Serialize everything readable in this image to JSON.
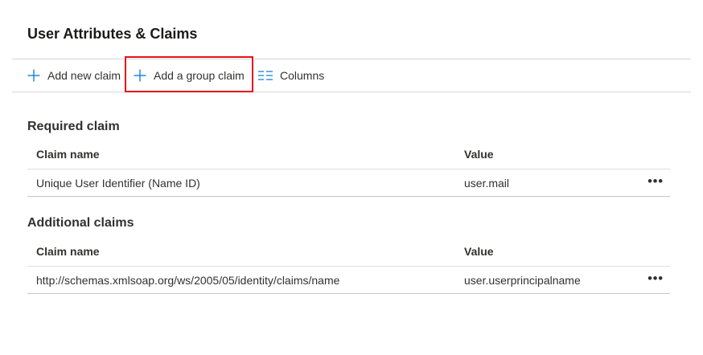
{
  "page": {
    "title": "User Attributes & Claims"
  },
  "toolbar": {
    "add_claim_label": "Add new claim",
    "add_group_claim_label": "Add a group claim",
    "columns_label": "Columns"
  },
  "colors": {
    "accent": "#0078d4",
    "highlight": "#e8101a"
  },
  "icons": {
    "add_claim": "plus-icon",
    "add_group_claim": "plus-icon",
    "columns": "columns-icon",
    "more": "more-options-icon"
  },
  "required": {
    "title": "Required claim",
    "columns": [
      "Claim name",
      "Value"
    ],
    "rows": [
      {
        "name": "Unique User Identifier (Name ID)",
        "value": "user.mail",
        "more": "•••"
      }
    ]
  },
  "additional": {
    "title": "Additional claims",
    "columns": [
      "Claim name",
      "Value"
    ],
    "rows": [
      {
        "name": "http://schemas.xmlsoap.org/ws/2005/05/identity/claims/name",
        "value": "user.userprincipalname",
        "more": "•••"
      }
    ]
  }
}
